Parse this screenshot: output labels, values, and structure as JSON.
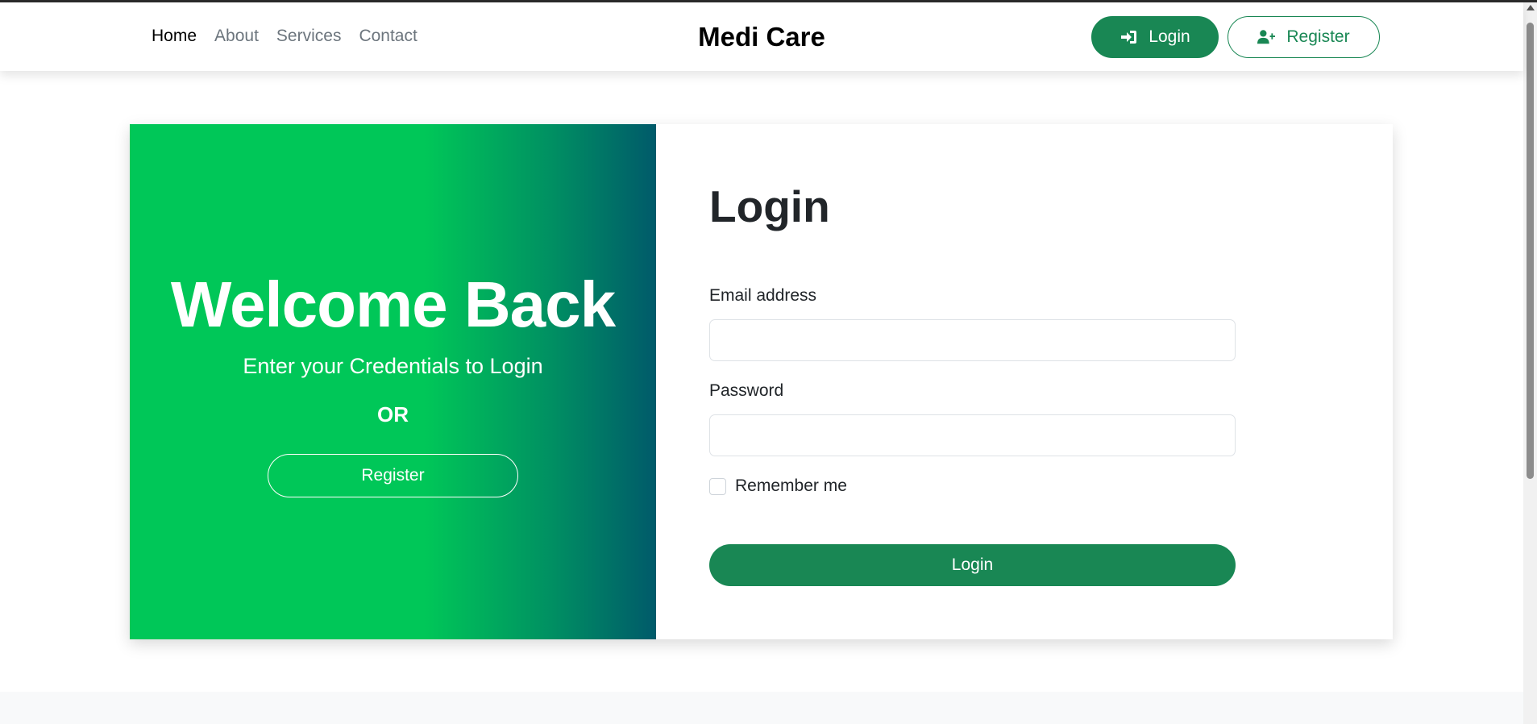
{
  "nav": {
    "links": [
      "Home",
      "About",
      "Services",
      "Contact"
    ],
    "brand": "Medi Care",
    "login_label": "Login",
    "register_label": "Register"
  },
  "welcome_panel": {
    "heading": "Welcome Back",
    "subheading": "Enter your Credentials to Login",
    "or_text": "OR",
    "register_label": "Register"
  },
  "login_form": {
    "title": "Login",
    "email_label": "Email address",
    "email_value": "",
    "password_label": "Password",
    "password_value": "",
    "remember_label": "Remember me",
    "remember_checked": false,
    "submit_label": "Login"
  },
  "colors": {
    "accent": "#198754",
    "gradient_start": "#00c758",
    "gradient_end": "#005a6a"
  },
  "icons": {
    "nav_login": "sign-in-icon",
    "nav_register": "user-plus-icon"
  }
}
